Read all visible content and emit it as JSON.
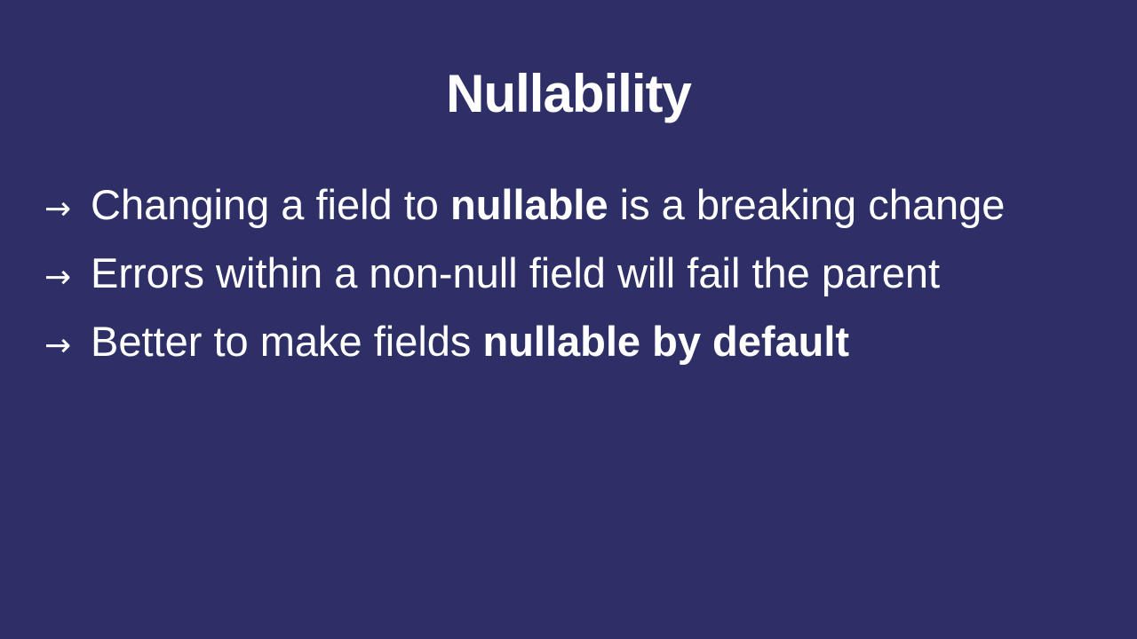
{
  "slide": {
    "background_color": "#2e2f66",
    "text_color": "#ffffff",
    "title": "Nullability",
    "bullet_marker": "→",
    "bullets": [
      {
        "parts": [
          {
            "text": "Changing a field to ",
            "bold": false
          },
          {
            "text": "nullable",
            "bold": true
          },
          {
            "text": " is a breaking change",
            "bold": false
          }
        ]
      },
      {
        "parts": [
          {
            "text": "Errors within a non-null field will fail the parent",
            "bold": false
          }
        ]
      },
      {
        "parts": [
          {
            "text": "Better to make fields ",
            "bold": false
          },
          {
            "text": "nullable by default",
            "bold": true
          }
        ]
      }
    ]
  }
}
